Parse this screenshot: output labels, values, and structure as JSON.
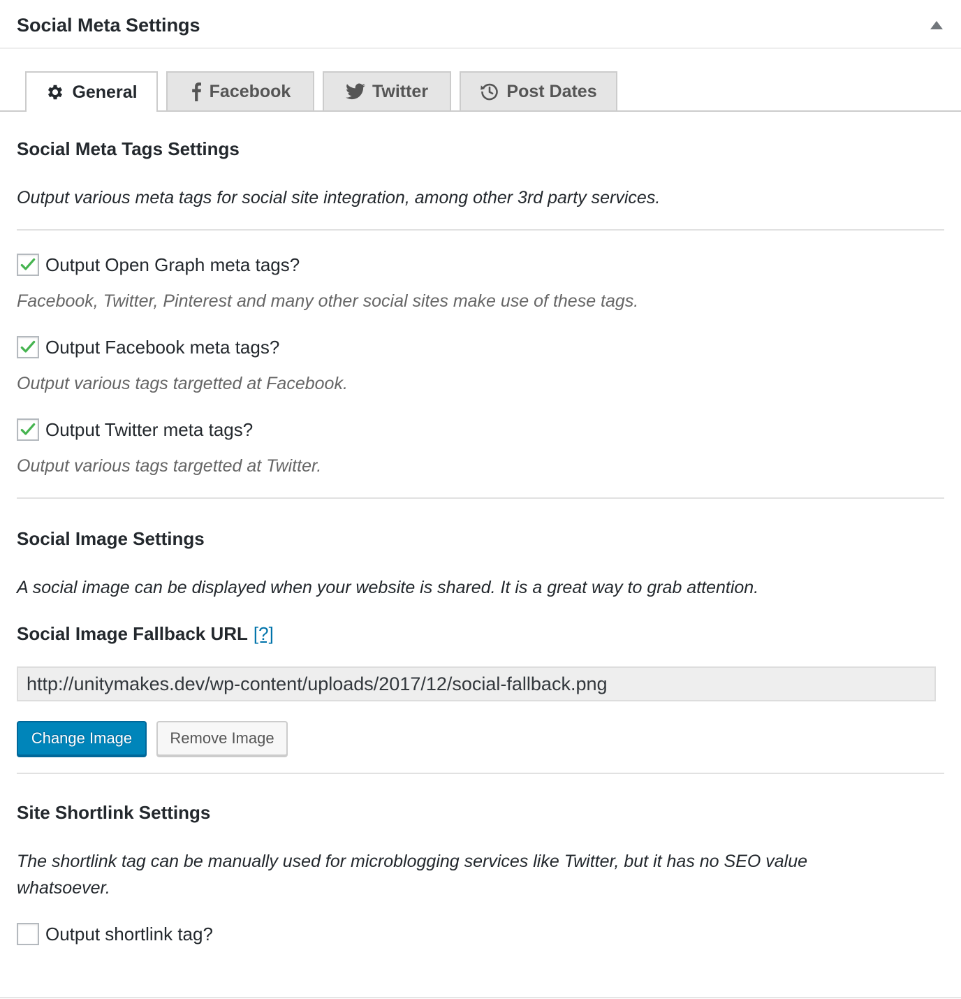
{
  "panel": {
    "title": "Social Meta Settings",
    "toggle_icon": "triangle-up-icon"
  },
  "tabs": [
    {
      "label": "General",
      "icon": "gear-icon",
      "active": true
    },
    {
      "label": "Facebook",
      "icon": "facebook-icon",
      "active": false
    },
    {
      "label": "Twitter",
      "icon": "twitter-icon",
      "active": false
    },
    {
      "label": "Post Dates",
      "icon": "history-icon",
      "active": false
    }
  ],
  "meta_tags": {
    "heading": "Social Meta Tags Settings",
    "description": "Output various meta tags for social site integration, among other 3rd party services.",
    "options": [
      {
        "label": "Output Open Graph meta tags?",
        "checked": true,
        "help": "Facebook, Twitter, Pinterest and many other social sites make use of these tags."
      },
      {
        "label": "Output Facebook meta tags?",
        "checked": true,
        "help": "Output various tags targetted at Facebook."
      },
      {
        "label": "Output Twitter meta tags?",
        "checked": true,
        "help": "Output various tags targetted at Twitter."
      }
    ]
  },
  "image": {
    "heading": "Social Image Settings",
    "description": "A social image can be displayed when your website is shared. It is a great way to grab attention.",
    "field_label": "Social Image Fallback URL",
    "help_link": "[?]",
    "url_value": "http://unitymakes.dev/wp-content/uploads/2017/12/social-fallback.png",
    "change_button": "Change Image",
    "remove_button": "Remove Image"
  },
  "shortlink": {
    "heading": "Site Shortlink Settings",
    "description_line1": "The shortlink tag can be manually used for microblogging services like Twitter, but it has no SEO value",
    "description_line2": "whatsoever.",
    "option_label": "Output shortlink tag?",
    "checked": false
  },
  "colors": {
    "accent": "#0085ba",
    "check": "#1e8cbe",
    "checkmark": "#46b450",
    "link": "#0073aa"
  }
}
